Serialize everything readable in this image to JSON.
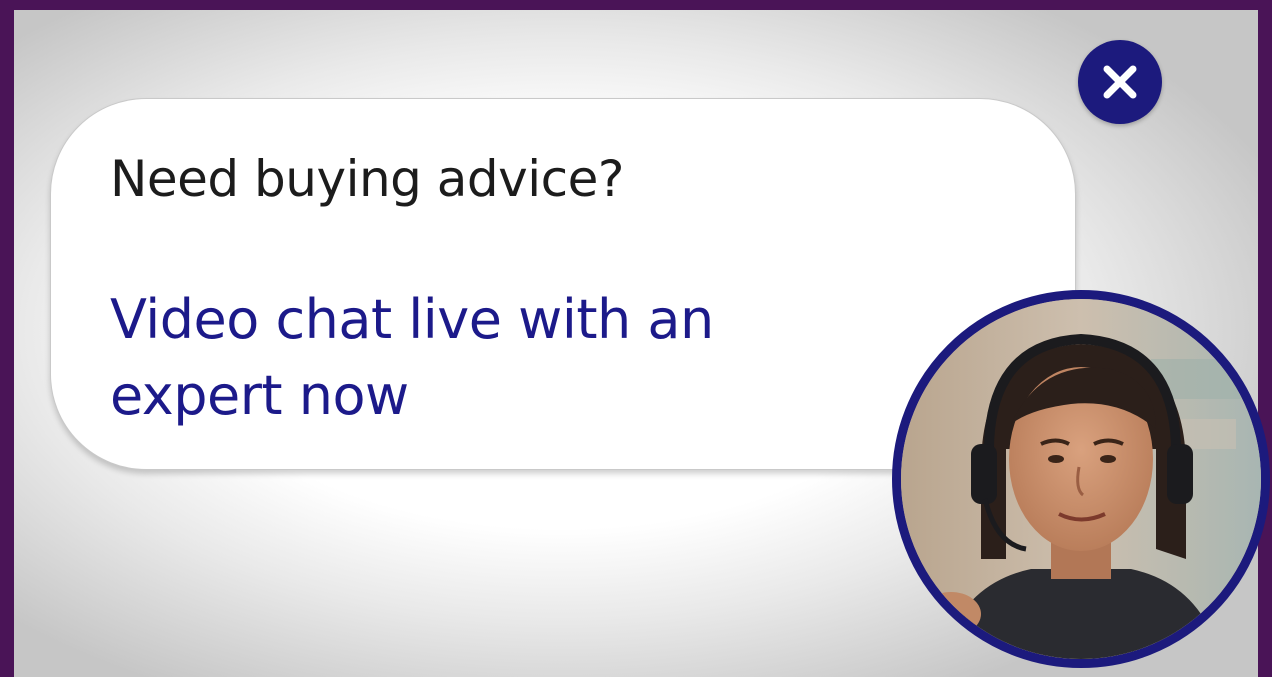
{
  "widget": {
    "headline": "Need buying advice?",
    "cta_text": "Video chat live with an expert now",
    "close_icon": "close-icon",
    "avatar_icon": "expert-avatar"
  },
  "colors": {
    "frame": "#4a1457",
    "accent": "#1c1a7d",
    "cta_text": "#1c1a8a",
    "headline_text": "#1c1c1c"
  }
}
